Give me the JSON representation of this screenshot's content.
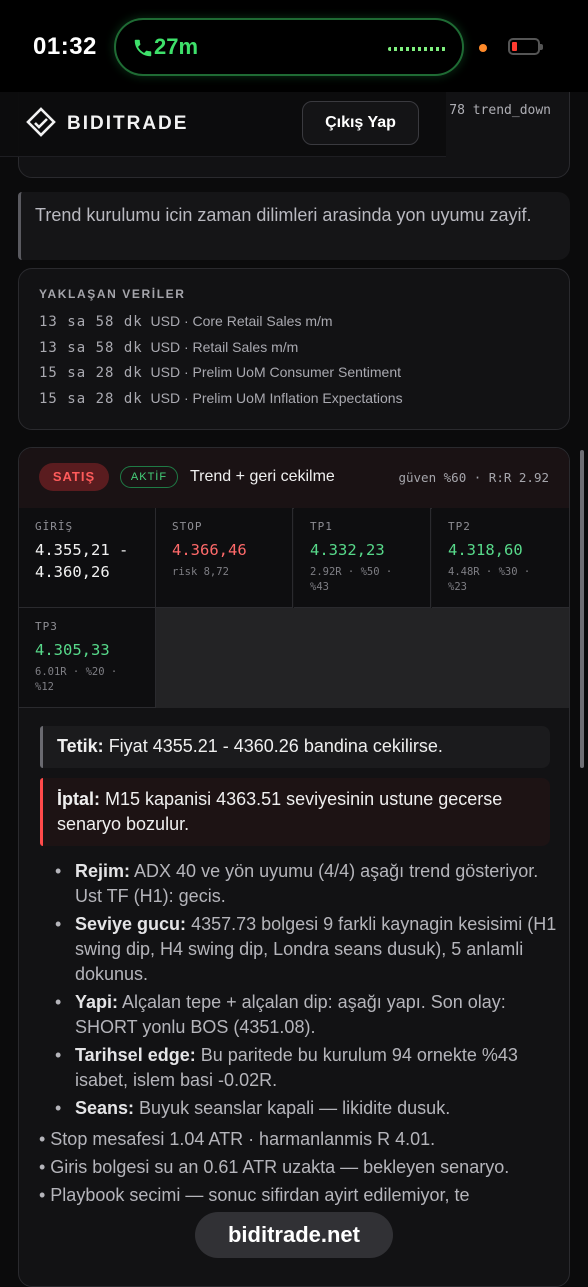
{
  "status_bar": {
    "time": "01:32",
    "call_duration": "27m"
  },
  "header": {
    "brand": "BIDITRADE",
    "logout_label": "Çıkış Yap",
    "behind_snippet": "78 trend_down"
  },
  "warning_note": "Trend kurulumu icin zaman dilimleri arasinda yon uyumu zayif.",
  "upcoming": {
    "title": "YAKLAŞAN VERİLER",
    "items": [
      {
        "time": "13 sa 58 dk",
        "text": "USD · Core Retail Sales m/m"
      },
      {
        "time": "13 sa 58 dk",
        "text": "USD · Retail Sales m/m"
      },
      {
        "time": "15 sa 28 dk",
        "text": "USD · Prelim UoM Consumer Sentiment"
      },
      {
        "time": "15 sa 28 dk",
        "text": "USD · Prelim UoM Inflation Expectations"
      }
    ]
  },
  "trade": {
    "side": "SATIŞ",
    "status": "AKTİF",
    "setup": "Trend + geri cekilme",
    "confidence": "güven %60 · R:R 2.92",
    "entry": {
      "label": "GİRİŞ",
      "value": "4.355,21 - 4.360,26"
    },
    "stop": {
      "label": "STOP",
      "value": "4.366,46",
      "sub": "risk 8,72"
    },
    "tp1": {
      "label": "TP1",
      "value": "4.332,23",
      "sub": "2.92R · %50 · %43"
    },
    "tp2": {
      "label": "TP2",
      "value": "4.318,60",
      "sub": "4.48R · %30 · %23"
    },
    "tp3": {
      "label": "TP3",
      "value": "4.305,33",
      "sub": "6.01R · %20 · %12"
    },
    "trigger": {
      "label": "Tetik:",
      "text": "Fiyat 4355.21 - 4360.26 bandina cekilirse."
    },
    "cancel": {
      "label": "İptal:",
      "text": "M15 kapanisi 4363.51 seviyesinin ustune gecerse senaryo bozulur."
    },
    "bullets": [
      {
        "label": "Rejim:",
        "text": "ADX 40 ve yön uyumu (4/4) aşağı trend gösteriyor. Ust TF (H1): gecis."
      },
      {
        "label": "Seviye gucu:",
        "text": "4357.73 bolgesi 9 farkli kaynagin kesisimi (H1 swing dip, H4 swing dip, Londra seans dusuk), 5 anlamli dokunus."
      },
      {
        "label": "Yapi:",
        "text": "Alçalan tepe + alçalan dip: aşağı yapı. Son olay: SHORT yonlu BOS (4351.08)."
      },
      {
        "label": "Tarihsel edge:",
        "text": "Bu paritede bu kurulum 94 ornekte %43 isabet, islem basi -0.02R."
      },
      {
        "label": "Seans:",
        "text": "Buyuk seanslar kapali — likidite dusuk."
      }
    ],
    "notes": [
      "• Stop mesafesi 1.04 ATR · harmanlanmis R 4.01.",
      "• Giris bolgesi su an 0.61 ATR uzakta — bekleyen senaryo.",
      "• Playbook secimi         — sonuc sifirdan ayirt edilemiyor, te"
    ]
  },
  "watermark": "biditrade.net"
}
